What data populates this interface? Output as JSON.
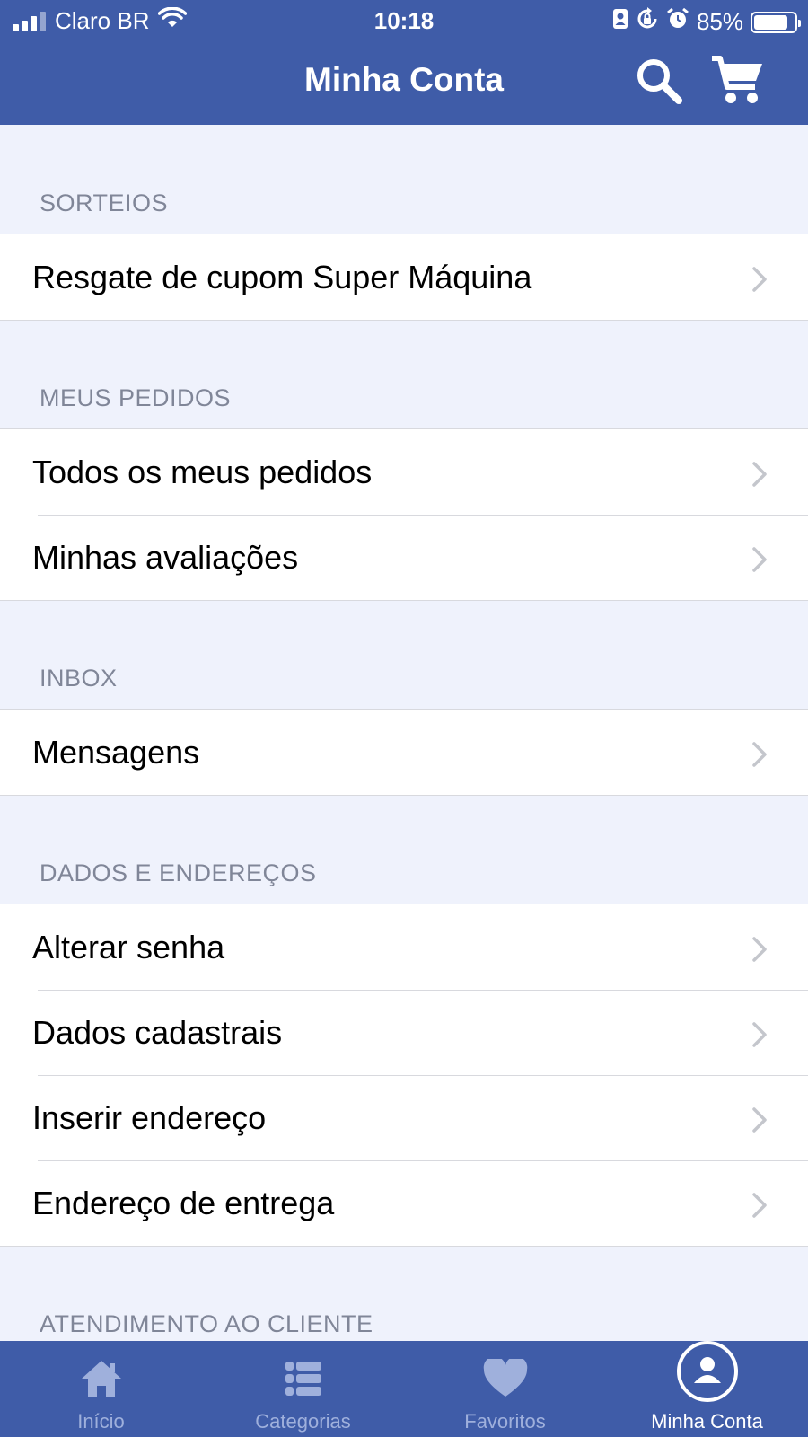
{
  "status_bar": {
    "carrier": "Claro BR",
    "time": "10:18",
    "battery": "85%",
    "battery_level": 0.85
  },
  "header": {
    "title": "Minha Conta",
    "search_icon": "search-icon",
    "cart_icon": "cart-icon"
  },
  "sections": [
    {
      "title": "SORTEIOS",
      "items": [
        "Resgate de cupom Super Máquina"
      ]
    },
    {
      "title": "MEUS PEDIDOS",
      "items": [
        "Todos os meus pedidos",
        "Minhas avaliações"
      ]
    },
    {
      "title": "INBOX",
      "items": [
        "Mensagens"
      ]
    },
    {
      "title": "DADOS E ENDEREÇOS",
      "items": [
        "Alterar senha",
        "Dados cadastrais",
        "Inserir endereço",
        "Endereço de entrega"
      ]
    },
    {
      "title": "ATENDIMENTO AO CLIENTE",
      "items": []
    }
  ],
  "tabbar": {
    "tabs": [
      {
        "label": "Início",
        "icon": "home-icon",
        "active": false
      },
      {
        "label": "Categorias",
        "icon": "list-icon",
        "active": false
      },
      {
        "label": "Favoritos",
        "icon": "heart-icon",
        "active": false
      },
      {
        "label": "Minha Conta",
        "icon": "user-icon",
        "active": true
      }
    ]
  },
  "colors": {
    "brand": "#3f5ca8",
    "background": "#eff2fc",
    "section_text": "#808698",
    "inactive_tab": "#9fb0dc"
  }
}
